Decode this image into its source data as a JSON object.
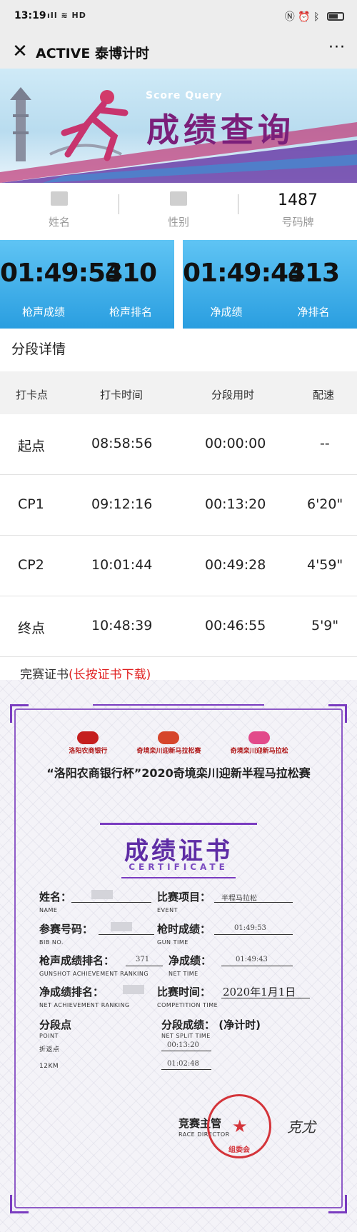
{
  "status_bar": {
    "time": "13:19",
    "signal": "ıIl",
    "network": "HD"
  },
  "title_bar": {
    "title": "ACTIVE 泰博计时"
  },
  "banner": {
    "subtitle": "Score Query",
    "title": "成绩查询"
  },
  "identity": [
    {
      "label": "姓名",
      "value": ""
    },
    {
      "label": "性别",
      "value": ""
    },
    {
      "label": "号码牌",
      "value": "1487"
    }
  ],
  "scores": {
    "gun_time": {
      "value": "01:49:53",
      "label": "枪声成绩"
    },
    "gun_rank": {
      "value": "410",
      "label": "枪声排名"
    },
    "net_time": {
      "value": "01:49:43",
      "label": "净成绩"
    },
    "net_rank": {
      "value": "413",
      "label": "净排名"
    }
  },
  "splits": {
    "title": "分段详情",
    "headers": [
      "打卡点",
      "打卡时间",
      "分段用时",
      "配速"
    ],
    "rows": [
      {
        "point": "起点",
        "time": "08:58:56",
        "split": "00:00:00",
        "pace": "--"
      },
      {
        "point": "CP1",
        "time": "09:12:16",
        "split": "00:13:20",
        "pace": "6'20\""
      },
      {
        "point": "CP2",
        "time": "10:01:44",
        "split": "00:49:28",
        "pace": "4'59\""
      },
      {
        "point": "终点",
        "time": "10:48:39",
        "split": "00:46:55",
        "pace": "5'9\""
      }
    ]
  },
  "certificate": {
    "section_title": "完赛证书",
    "section_hint": "(长按证书下载)",
    "logos": [
      "洛阳农商银行",
      "奇境栾川迎新马拉松赛",
      "奇境栾川迎新马拉松"
    ],
    "event": "“洛阳农商银行杯”2020奇境栾川迎新半程马拉松赛",
    "heading": "成绩证书",
    "heading_en": "CERTIFICATE",
    "fields": {
      "name_label": "姓名：",
      "name_en": "NAME",
      "event_label": "比赛项目：",
      "event_en": "EVENT",
      "event_value": "半程马拉松",
      "bib_label": "参赛号码：",
      "bib_en": "BIB NO.",
      "gun_label": "枪时成绩：",
      "gun_en": "GUN TIME",
      "gun_value": "01:49:53",
      "gun_rank_label": "枪声成绩排名：",
      "gun_rank_en": "GUNSHOT ACHIEVEMENT RANKING",
      "gun_rank_value": "371",
      "net_label": "净成绩：",
      "net_en": "NET TIME",
      "net_value": "01:49:43",
      "net_rank_label": "净成绩排名：",
      "net_rank_en": "NET ACHIEVEMENT RANKING",
      "date_label": "比赛时间：",
      "date_en": "COMPETITION TIME",
      "date_value": "2020年1月1日",
      "point_label": "分段点",
      "point_en": "POINT",
      "split_label": "分段成绩：",
      "split_note": "(净计时)",
      "split_en": "NET SPLIT TIME",
      "split_rows": [
        {
          "point": "折返点",
          "time": "00:13:20"
        },
        {
          "point": "12KM",
          "time": "01:02:48"
        }
      ],
      "director_label": "竞赛主管",
      "director_en": "RACE DIRECTOR",
      "stamp_text": "组委会",
      "signature": "克尤"
    }
  },
  "colors": {
    "score_card_top": "#5fc4f4",
    "score_card_bottom": "#2a9ee0",
    "banner_title": "#7b1f7a",
    "certificate_accent": "#5e2ca5",
    "hint_red": "#e02020"
  }
}
